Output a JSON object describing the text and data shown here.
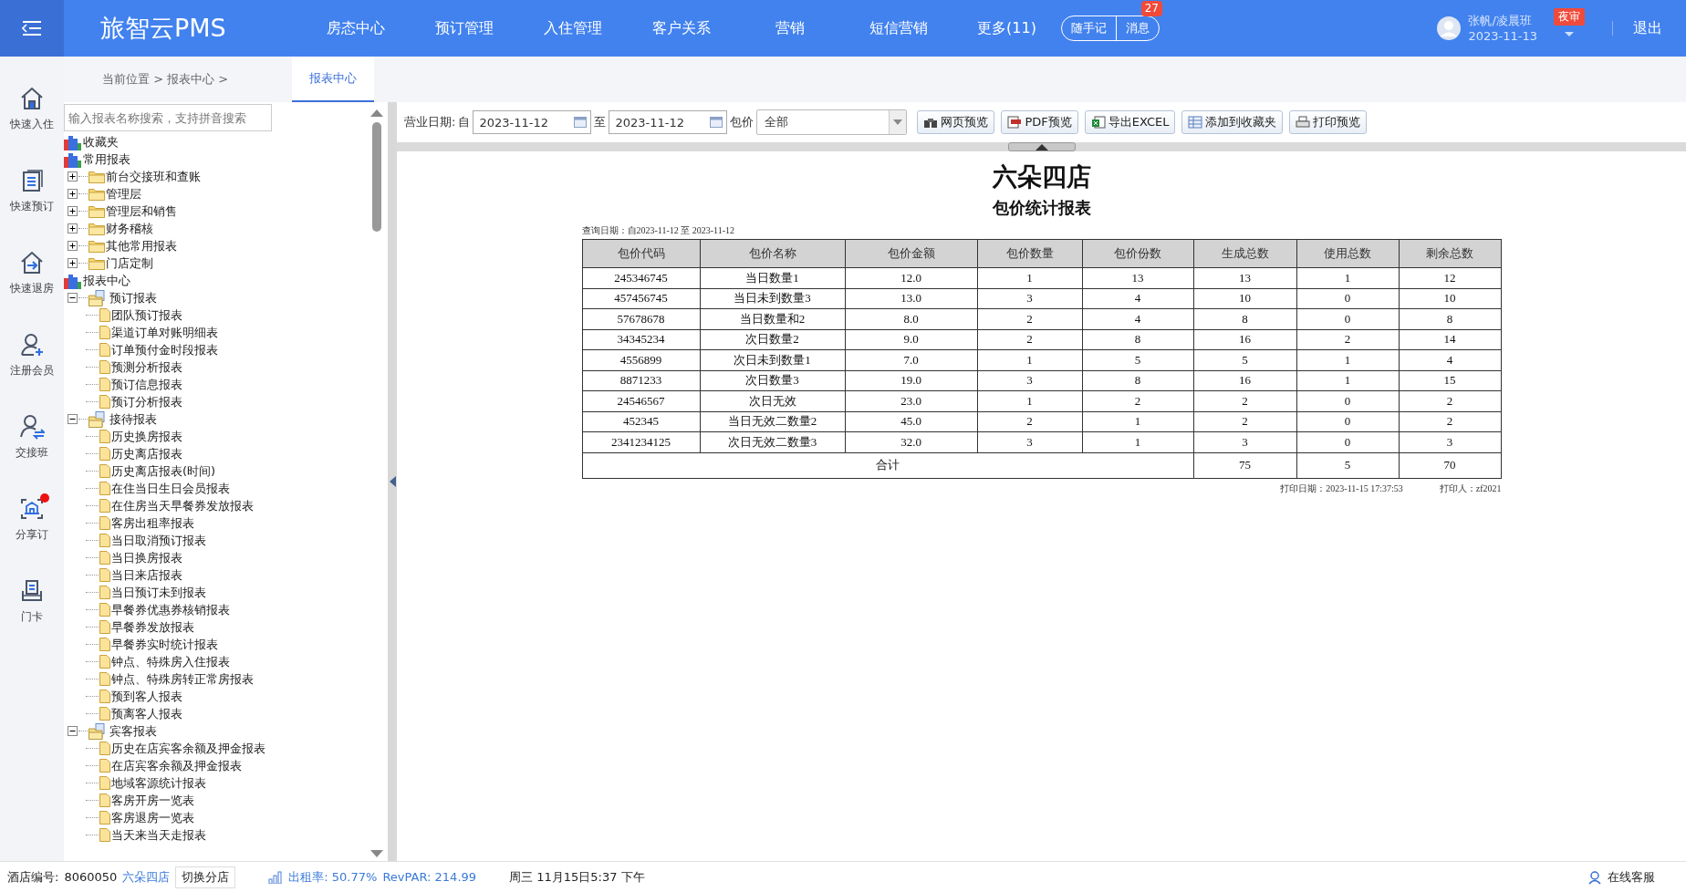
{
  "top_bar": {
    "logo": "旅智云PMS",
    "nav": [
      {
        "label": "房态中心"
      },
      {
        "label": "预订管理"
      },
      {
        "label": "入住管理"
      },
      {
        "label": "客户关系"
      },
      {
        "label": "营销"
      },
      {
        "label": "短信营销"
      },
      {
        "label": "更多(11)"
      }
    ],
    "note": "随手记",
    "messages": "消息",
    "message_count": "27",
    "user": {
      "name": "张帆/凌晨班",
      "date": "2023-11-13"
    },
    "night_audit": "夜审",
    "logout": "退出"
  },
  "sidebar": {
    "items": [
      {
        "label": "快速入住",
        "kind": "home",
        "alert": false
      },
      {
        "label": "快速预订",
        "kind": "list",
        "alert": false
      },
      {
        "label": "快速退房",
        "kind": "checkout",
        "alert": false
      },
      {
        "label": "注册会员",
        "kind": "user-add",
        "alert": false
      },
      {
        "label": "交接班",
        "kind": "user-swap",
        "alert": false
      },
      {
        "label": "分享订",
        "kind": "share",
        "alert": true
      },
      {
        "label": "门卡",
        "kind": "card",
        "alert": false
      }
    ]
  },
  "breadcrumb": "当前位置 > 报表中心 >",
  "tabs": [
    {
      "label": "报表中心",
      "selected": true
    }
  ],
  "tree": {
    "placeholder": "输入报表名称搜索，支持拼音搜索",
    "nodes": [
      {
        "label": "收藏夹",
        "kind": "root"
      },
      {
        "label": "常用报表",
        "kind": "root",
        "children": [
          {
            "label": "前台交接班和查账",
            "kind": "folder",
            "expanded": false
          },
          {
            "label": "管理层",
            "kind": "folder",
            "expanded": false
          },
          {
            "label": "管理层和销售",
            "kind": "folder",
            "expanded": false
          },
          {
            "label": "财务稽核",
            "kind": "folder",
            "expanded": false
          },
          {
            "label": "其他常用报表",
            "kind": "folder",
            "expanded": false
          },
          {
            "label": "门店定制",
            "kind": "folder",
            "expanded": false
          }
        ]
      },
      {
        "label": "报表中心",
        "kind": "root",
        "children": [
          {
            "label": "预订报表",
            "kind": "folder",
            "expanded": true,
            "children": [
              {
                "label": "团队预订报表",
                "kind": "report"
              },
              {
                "label": "渠道订单对账明细表",
                "kind": "report"
              },
              {
                "label": "订单预付金时段报表",
                "kind": "report"
              },
              {
                "label": "预测分析报表",
                "kind": "report"
              },
              {
                "label": "预订信息报表",
                "kind": "report"
              },
              {
                "label": "预订分析报表",
                "kind": "report"
              }
            ]
          },
          {
            "label": "接待报表",
            "kind": "folder",
            "expanded": true,
            "children": [
              {
                "label": "历史换房报表",
                "kind": "report"
              },
              {
                "label": "历史离店报表",
                "kind": "report"
              },
              {
                "label": "历史离店报表(时间)",
                "kind": "report"
              },
              {
                "label": "在住当日生日会员报表",
                "kind": "report"
              },
              {
                "label": "在住房当天早餐券发放报表",
                "kind": "report"
              },
              {
                "label": "客房出租率报表",
                "kind": "report"
              },
              {
                "label": "当日取消预订报表",
                "kind": "report"
              },
              {
                "label": "当日换房报表",
                "kind": "report"
              },
              {
                "label": "当日来店报表",
                "kind": "report"
              },
              {
                "label": "当日预订未到报表",
                "kind": "report"
              },
              {
                "label": "早餐券优惠券核销报表",
                "kind": "report"
              },
              {
                "label": "早餐券发放报表",
                "kind": "report"
              },
              {
                "label": "早餐券实时统计报表",
                "kind": "report"
              },
              {
                "label": "钟点、特殊房入住报表",
                "kind": "report"
              },
              {
                "label": "钟点、特殊房转正常房报表",
                "kind": "report"
              },
              {
                "label": "预到客人报表",
                "kind": "report"
              },
              {
                "label": "预离客人报表",
                "kind": "report"
              }
            ]
          },
          {
            "label": "宾客报表",
            "kind": "folder",
            "expanded": true,
            "children": [
              {
                "label": "历史在店宾客余额及押金报表",
                "kind": "report"
              },
              {
                "label": "在店宾客余额及押金报表",
                "kind": "report"
              },
              {
                "label": "地域客源统计报表",
                "kind": "report"
              },
              {
                "label": "客房开房一览表",
                "kind": "report"
              },
              {
                "label": "客房退房一览表",
                "kind": "report"
              },
              {
                "label": "当天来当天走报表",
                "kind": "report"
              }
            ]
          }
        ]
      }
    ]
  },
  "toolbar": {
    "date_label": "营业日期:",
    "from_label": "自",
    "from": "2023-11-12",
    "to_label": "至",
    "to": "2023-11-12",
    "package_label": "包价",
    "package": "全部",
    "buttons": [
      {
        "label": "网页预览",
        "kind": "web"
      },
      {
        "label": "PDF预览",
        "kind": "pdf"
      },
      {
        "label": "导出EXCEL",
        "kind": "excel"
      },
      {
        "label": "添加到收藏夹",
        "kind": "favorite"
      },
      {
        "label": "打印预览",
        "kind": "print"
      }
    ]
  },
  "report": {
    "hotel": "六朵四店",
    "title": "包价统计报表",
    "query_date": "查询日期：自2023-11-12 至 2023-11-12",
    "columns": [
      "包价代码",
      "包价名称",
      "包价金额",
      "包价数量",
      "包价份数",
      "生成总数",
      "使用总数",
      "剩余总数"
    ],
    "rows": [
      [
        "245346745",
        "当日数量1",
        "12.0",
        "1",
        "13",
        "13",
        "1",
        "12"
      ],
      [
        "457456745",
        "当日未到数量3",
        "13.0",
        "3",
        "4",
        "10",
        "0",
        "10"
      ],
      [
        "57678678",
        "当日数量和2",
        "8.0",
        "2",
        "4",
        "8",
        "0",
        "8"
      ],
      [
        "34345234",
        "次日数量2",
        "9.0",
        "2",
        "8",
        "16",
        "2",
        "14"
      ],
      [
        "4556899",
        "次日未到数量1",
        "7.0",
        "1",
        "5",
        "5",
        "1",
        "4"
      ],
      [
        "8871233",
        "次日数量3",
        "19.0",
        "3",
        "8",
        "16",
        "1",
        "15"
      ],
      [
        "24546567",
        "次日无效",
        "23.0",
        "1",
        "2",
        "2",
        "0",
        "2"
      ],
      [
        "452345",
        "当日无效二数量2",
        "45.0",
        "2",
        "1",
        "2",
        "0",
        "2"
      ],
      [
        "2341234125",
        "次日无效二数量3",
        "32.0",
        "3",
        "1",
        "3",
        "0",
        "3"
      ]
    ],
    "total": {
      "label": "合计",
      "values": [
        "75",
        "5",
        "70"
      ]
    },
    "print_date": "打印日期：2023-11-15 17:37:53",
    "printer": "打印人：zf2021"
  },
  "status_bar": {
    "hotel_no_label": "酒店编号:",
    "hotel_no": "8060050",
    "hotel_name": "六朵四店",
    "switch": "切换分店",
    "occupancy": "出租率: 50.77%",
    "revpar": "RevPAR: 214.99",
    "datetime": "周三 11月15日5:37 下午",
    "support": "在线客服"
  }
}
